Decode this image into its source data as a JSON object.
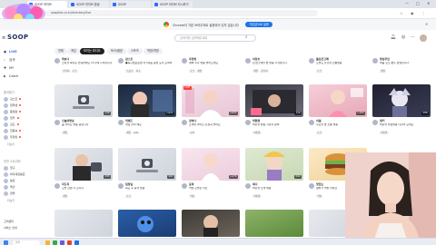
{
  "browser": {
    "tabs": [
      {
        "label": "SOOP 라이브",
        "active": true
      },
      {
        "label": "SOOP 라이브 방송",
        "active": false
      },
      {
        "label": "SOOP",
        "active": false
      },
      {
        "label": "SOOP 라이브 다시보기",
        "active": false
      }
    ],
    "url": "sooplive.co.kr/directory/live",
    "window_controls": [
      "—",
      "□",
      "✕"
    ]
  },
  "notice": {
    "text": "Chrome이 기본 브라우저로 설정되어 있지 않습니다",
    "button": "기본값으로 설정"
  },
  "site": {
    "logo": "SOOP",
    "search_placeholder": "검색어를 입력해주세요",
    "header_icons": [
      "bell-icon",
      "broadcast-icon",
      "grid-icon"
    ]
  },
  "sidebar": {
    "nav": [
      {
        "label": "LIVE",
        "icon": "●",
        "active": true
      },
      {
        "label": "검색",
        "icon": "⌕",
        "active": false
      },
      {
        "label": "MY",
        "icon": "♥",
        "active": false
      },
      {
        "label": "Catch",
        "icon": "▶",
        "active": false
      }
    ],
    "favorites_header": "즐겨찾기",
    "favorites": [
      "감스트",
      "침착맨",
      "풍월량",
      "릴카",
      "김도",
      "한동숙",
      "우정잉"
    ],
    "more_label": "더보기",
    "recommend_header": "추천 스트리머",
    "recommends": [
      "철구",
      "와꾸대장봉준",
      "봉준",
      "케인",
      "양띵"
    ],
    "more_label_2": "더보기",
    "footer": [
      "고객센터",
      "서비스 안내"
    ]
  },
  "filters": [
    "전체",
    "게임",
    "보이는 라디오",
    "토크/캠방",
    "스포츠",
    "먹방/쿡방"
  ],
  "cards_row1": [
    {
      "name": "따효니",
      "title": "스파클 짜주는 안녕하세요 11시에 시작합니다",
      "tags": [
        "한국어",
        "토크"
      ],
      "viewers": "1,204"
    },
    {
      "name": "감스트",
      "title": "●축구뽀로로맨 국가대표 응원 모두 모여라",
      "tags": [
        "스포츠",
        "축구"
      ],
      "viewers": "8,432"
    },
    {
      "name": "우정잉",
      "title": "새벽 수다 방송 놀러오세요",
      "tags": [
        "토크",
        "캠방"
      ],
      "viewers": "2,110"
    },
    {
      "name": "이상호",
      "title": "[신입] 매일 밤 방송 시작합니다",
      "tags": [
        "게임",
        "한국어"
      ],
      "viewers": "936"
    },
    {
      "name": "울산큰고래",
      "title": "오늘도 즐겁게 소통방송",
      "tags": [
        "토크"
      ],
      "viewers": "1,507"
    },
    {
      "name": "방송주인",
      "title": "처음 오신 분들 환영합니다",
      "tags": [
        "캠방"
      ],
      "viewers": "642"
    }
  ],
  "cards_row2": [
    {
      "name": "오늘의방송",
      "title": "숲 라이브 방송 중입니다",
      "tags": [
        "게임"
      ],
      "viewers": "318"
    },
    {
      "name": "빅헤드",
      "title": "게임 같이 해요",
      "tags": [
        "게임",
        "LOL"
      ],
      "viewers": "1,022"
    },
    {
      "name": "강하나",
      "title": "노래방 라이브 신청곡 받아요",
      "tags": [
        "보라"
      ],
      "viewers": "2,845"
    },
    {
      "name": "박현정",
      "title": "버츄얼 방송 시청자 참여",
      "tags": [
        "버츄얼"
      ],
      "viewers": "774"
    },
    {
      "name": "이설",
      "title": "수요일 밤 소통 방송",
      "tags": [
        "토크"
      ],
      "viewers": "1,390"
    },
    {
      "name": "밍키",
      "title": "버츄얼 아침방송 다같이 모여요",
      "tags": [
        "버츄얼"
      ],
      "viewers": "588"
    }
  ],
  "cards_row3": [
    {
      "name": "지도자",
      "title": "오늘 한판 더 갑니다",
      "tags": [
        "게임"
      ],
      "viewers": "455"
    },
    {
      "name": "팀장님",
      "title": "퇴근 후 휴식 방송",
      "tags": [
        "토크"
      ],
      "viewers": "903"
    },
    {
      "name": "윤하",
      "title": "먹방 오늘은 치킨",
      "tags": [
        "먹방"
      ],
      "viewers": "1,276"
    },
    {
      "name": "세나",
      "title": "버츄얼 노래 방송",
      "tags": [
        "버츄얼"
      ],
      "viewers": "692"
    },
    {
      "name": "맛있는",
      "title": "햄버거 먹방 라이브",
      "tags": [
        "먹방"
      ],
      "viewers": "1,044"
    }
  ],
  "taskbar": {
    "search": "검색"
  }
}
